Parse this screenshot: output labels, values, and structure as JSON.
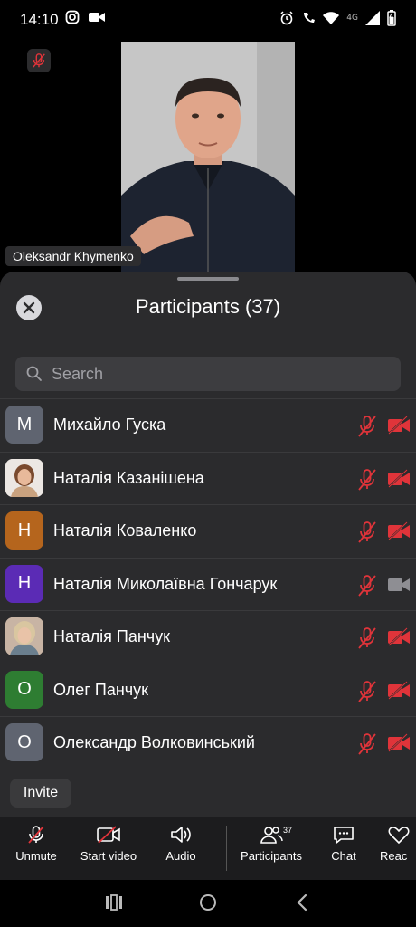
{
  "status": {
    "time": "14:10",
    "network": "4G"
  },
  "video": {
    "speaker_name": "Oleksandr Khymenko"
  },
  "sheet": {
    "title": "Participants (37)",
    "search_placeholder": "Search",
    "invite_label": "Invite"
  },
  "participants": [
    {
      "initial": "M",
      "name": "Михайло Гуска",
      "avatar_color": "#5f6470",
      "photo": false,
      "mic": "muted",
      "video": "off"
    },
    {
      "initial": "",
      "name": "Наталія Казанішена",
      "avatar_color": "#d9cfc9",
      "photo": true,
      "mic": "muted",
      "video": "off"
    },
    {
      "initial": "Н",
      "name": "Наталія Коваленко",
      "avatar_color": "#b5651d",
      "photo": false,
      "mic": "muted",
      "video": "off"
    },
    {
      "initial": "Н",
      "name": "Наталія Миколаївна Гончарук",
      "avatar_color": "#5b2bb5",
      "photo": false,
      "mic": "muted",
      "video": "on"
    },
    {
      "initial": "",
      "name": "Наталія Панчук",
      "avatar_color": "#cdb8a8",
      "photo": true,
      "mic": "muted",
      "video": "off"
    },
    {
      "initial": "О",
      "name": "Олег Панчук",
      "avatar_color": "#2e7d32",
      "photo": false,
      "mic": "muted",
      "video": "off"
    },
    {
      "initial": "О",
      "name": "Олександр Волковинський",
      "avatar_color": "#5f6470",
      "photo": false,
      "mic": "muted",
      "video": "off"
    }
  ],
  "toolbar": {
    "unmute": "Unmute",
    "start_video": "Start video",
    "audio": "Audio",
    "participants": "Participants",
    "participants_count": "37",
    "chat": "Chat",
    "reactions": "Reac"
  },
  "colors": {
    "muted_red": "#e0343a",
    "sheet_bg": "#2b2b2d",
    "toolbar_bg": "#1c1c1e"
  }
}
